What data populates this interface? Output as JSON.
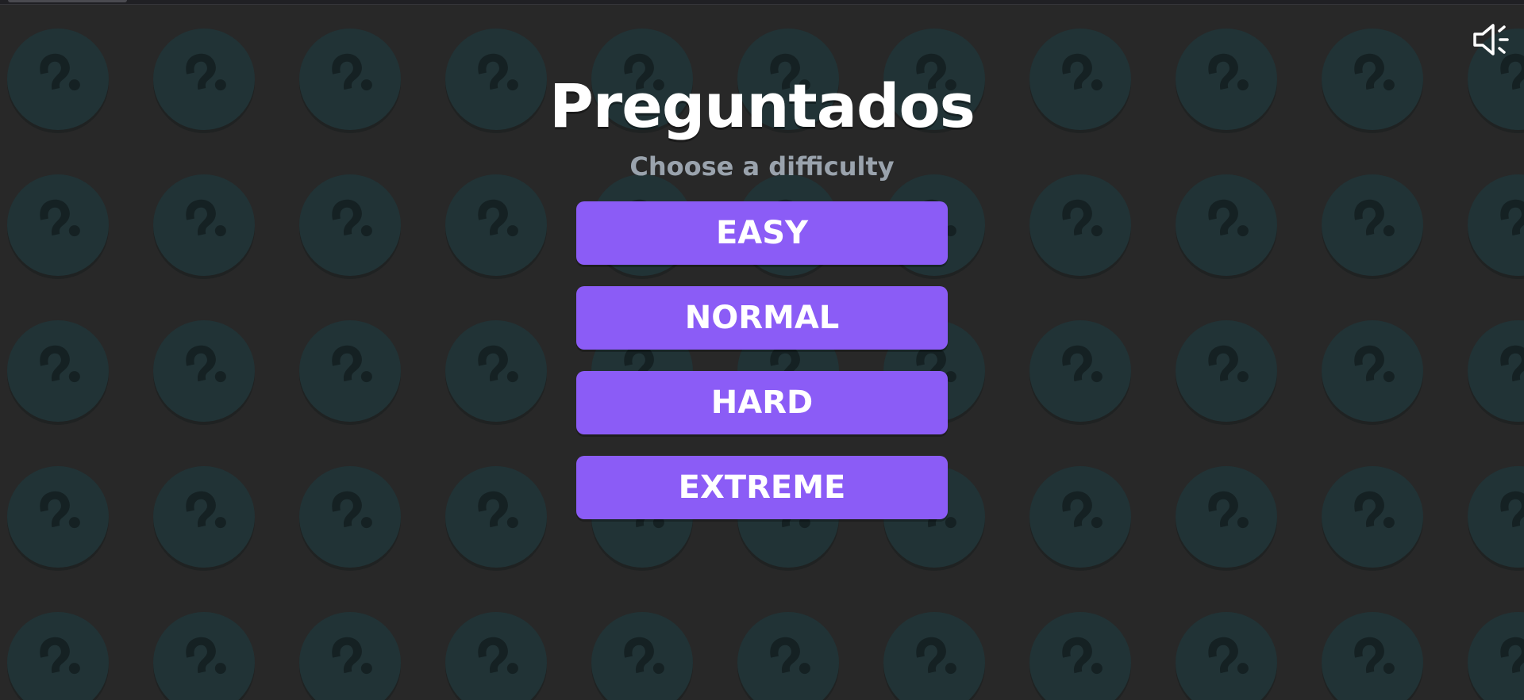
{
  "game": {
    "title": "Preguntados",
    "subtitle": "Choose a difficulty"
  },
  "difficulties": [
    {
      "label": "EASY"
    },
    {
      "label": "NORMAL"
    },
    {
      "label": "HARD"
    },
    {
      "label": "EXTREME"
    }
  ],
  "sound": {
    "icon": "speaker-volume-icon",
    "state": "on"
  },
  "background": {
    "icon": "question-mark-circle-icon"
  },
  "colors": {
    "background": "#282828",
    "pattern_circle": "#213336",
    "pattern_glyph": "#152123",
    "button": "#8b5cf6",
    "button_text": "#ffffff",
    "title": "#ffffff",
    "subtitle": "#9aa3ad",
    "icon": "#ffffff"
  }
}
